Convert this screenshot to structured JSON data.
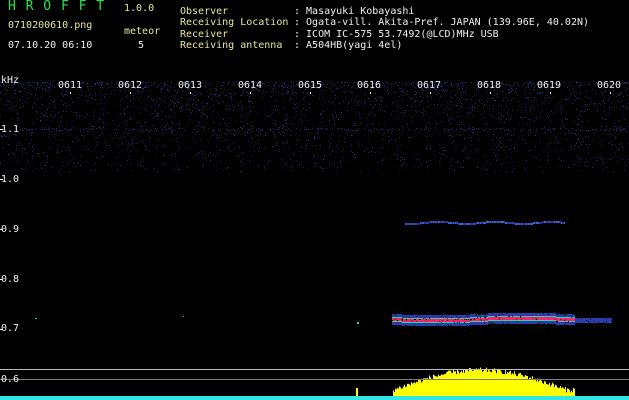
{
  "header": {
    "app_name": "H R O F F T",
    "app_version": "1.0.0",
    "filename": "0710200610.png",
    "datetime": "07.10.20 06:10",
    "meteor_label": "meteor",
    "meteor_count": "5",
    "observer_label": "Observer",
    "observer_value": ": Masayuki Kobayashi",
    "location_label": "Receiving Location",
    "location_value": ": Ogata-vill. Akita-Pref. JAPAN (139.96E, 40.02N)",
    "receiver_label": "Receiver",
    "receiver_value": ": ICOM IC-575 53.7492(@LCD)MHz USB",
    "antenna_label": "Receiving antenna",
    "antenna_value": ": A504HB(yagi 4el)"
  },
  "time_ticks": [
    "0611",
    "0612",
    "0613",
    "0614",
    "0615",
    "0616",
    "0617",
    "0618",
    "0619",
    "0620"
  ],
  "freq_axis": {
    "unit": "kHz",
    "labels": [
      "1.1",
      "1.0",
      "0.9",
      "0.8",
      "0.7",
      "0.6"
    ]
  },
  "colors": {
    "label_green": "#23e54a",
    "label_yellow": "#e8e59a",
    "noise_blue": "#2a3db0",
    "echo_red": "#ff1f6a",
    "echo_cyan": "#19d6d6",
    "echo_green": "#39e06a",
    "amplitude_yellow": "#ffff00",
    "amplitude_cyan": "#33e6e6"
  }
}
